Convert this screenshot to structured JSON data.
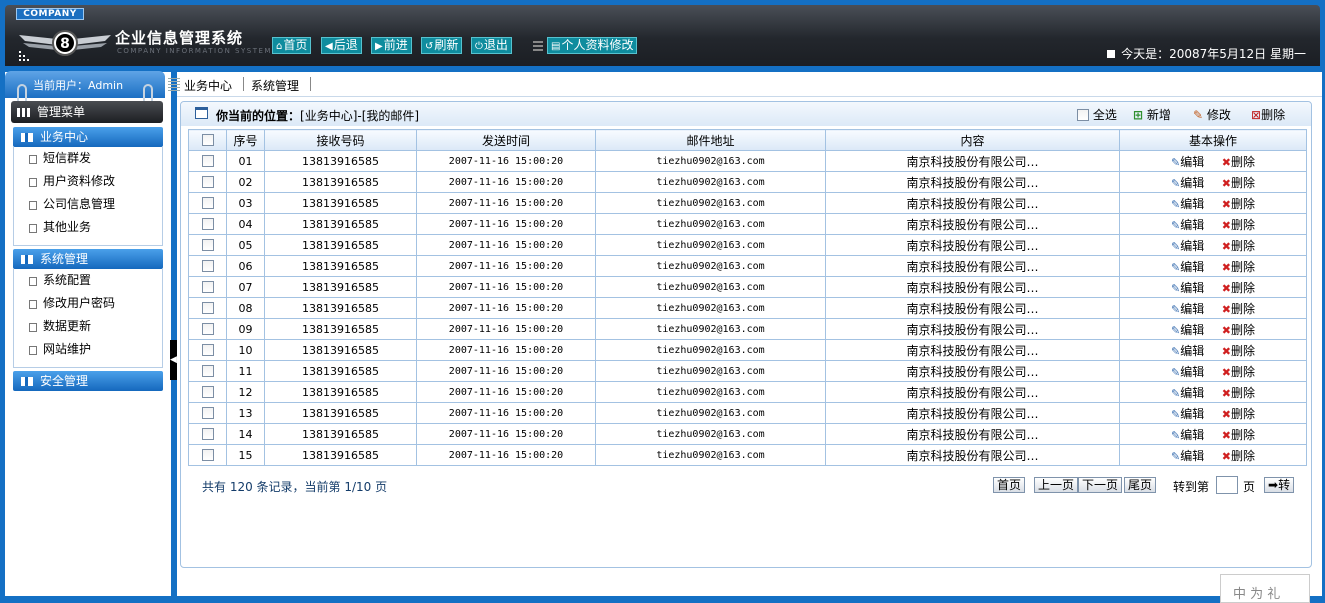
{
  "header": {
    "company": "COMPANY",
    "title": "企业信息管理系统",
    "subtitle": "COMPANY INFORMATION SYSTEM",
    "buttons": {
      "home": "首页",
      "back": "后退",
      "forward": "前进",
      "refresh": "刷新",
      "exit": "退出",
      "profile": "个人资料修改"
    },
    "today": "今天是：20087年5月12日 星期一"
  },
  "sidebar": {
    "user": "当前用户：Admin",
    "menu_title": "管理菜单",
    "sections": [
      {
        "title": "业务中心",
        "items": [
          "短信群发",
          "用户资料修改",
          "公司信息管理",
          "其他业务"
        ]
      },
      {
        "title": "系统管理",
        "items": [
          "系统配置",
          "修改用户密码",
          "数据更新",
          "网站维护"
        ]
      },
      {
        "title": "安全管理",
        "items": []
      }
    ]
  },
  "nav": {
    "tabs": [
      "业务中心",
      "系统管理"
    ]
  },
  "panel": {
    "location_label": "你当前的位置：",
    "location_path": "[业务中心]-[我的邮件]",
    "actions": {
      "select_all": "全选",
      "add": "新增",
      "edit": "修改",
      "delete": "删除"
    },
    "columns": [
      "序号",
      "接收号码",
      "发送时间",
      "邮件地址",
      "内容",
      "基本操作"
    ],
    "edit_label": "编辑",
    "delete_label": "删除",
    "rows": [
      {
        "no": "01",
        "phone": "13813916585",
        "time": "2007-11-16 15:00:20",
        "email": "tiezhu0902@163.com",
        "content": "南京科技股份有限公司…"
      },
      {
        "no": "02",
        "phone": "13813916585",
        "time": "2007-11-16 15:00:20",
        "email": "tiezhu0902@163.com",
        "content": "南京科技股份有限公司…"
      },
      {
        "no": "03",
        "phone": "13813916585",
        "time": "2007-11-16 15:00:20",
        "email": "tiezhu0902@163.com",
        "content": "南京科技股份有限公司…"
      },
      {
        "no": "04",
        "phone": "13813916585",
        "time": "2007-11-16 15:00:20",
        "email": "tiezhu0902@163.com",
        "content": "南京科技股份有限公司…"
      },
      {
        "no": "05",
        "phone": "13813916585",
        "time": "2007-11-16 15:00:20",
        "email": "tiezhu0902@163.com",
        "content": "南京科技股份有限公司…"
      },
      {
        "no": "06",
        "phone": "13813916585",
        "time": "2007-11-16 15:00:20",
        "email": "tiezhu0902@163.com",
        "content": "南京科技股份有限公司…"
      },
      {
        "no": "07",
        "phone": "13813916585",
        "time": "2007-11-16 15:00:20",
        "email": "tiezhu0902@163.com",
        "content": "南京科技股份有限公司…"
      },
      {
        "no": "08",
        "phone": "13813916585",
        "time": "2007-11-16 15:00:20",
        "email": "tiezhu0902@163.com",
        "content": "南京科技股份有限公司…"
      },
      {
        "no": "09",
        "phone": "13813916585",
        "time": "2007-11-16 15:00:20",
        "email": "tiezhu0902@163.com",
        "content": "南京科技股份有限公司…"
      },
      {
        "no": "10",
        "phone": "13813916585",
        "time": "2007-11-16 15:00:20",
        "email": "tiezhu0902@163.com",
        "content": "南京科技股份有限公司…"
      },
      {
        "no": "11",
        "phone": "13813916585",
        "time": "2007-11-16 15:00:20",
        "email": "tiezhu0902@163.com",
        "content": "南京科技股份有限公司…"
      },
      {
        "no": "12",
        "phone": "13813916585",
        "time": "2007-11-16 15:00:20",
        "email": "tiezhu0902@163.com",
        "content": "南京科技股份有限公司…"
      },
      {
        "no": "13",
        "phone": "13813916585",
        "time": "2007-11-16 15:00:20",
        "email": "tiezhu0902@163.com",
        "content": "南京科技股份有限公司…"
      },
      {
        "no": "14",
        "phone": "13813916585",
        "time": "2007-11-16 15:00:20",
        "email": "tiezhu0902@163.com",
        "content": "南京科技股份有限公司…"
      },
      {
        "no": "15",
        "phone": "13813916585",
        "time": "2007-11-16 15:00:20",
        "email": "tiezhu0902@163.com",
        "content": "南京科技股份有限公司…"
      }
    ],
    "pagination": {
      "info": "共有 120 条记录，当前第 1/10 页",
      "first": "首页",
      "prev": "上一页",
      "next": "下一页",
      "last": "尾页",
      "goto_label": "转到第",
      "page_unit": "页",
      "go": "转"
    }
  },
  "corner_stamp": "中 为 礼"
}
